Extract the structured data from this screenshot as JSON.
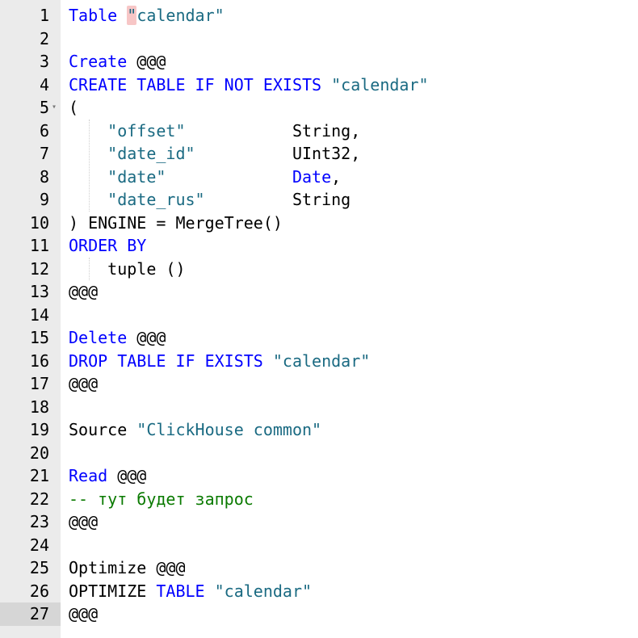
{
  "editor": {
    "active_line": 27,
    "lines": [
      {
        "n": "1",
        "tokens": [
          {
            "t": "Table",
            "c": "kw"
          },
          {
            "t": " ",
            "c": ""
          },
          {
            "t": "\"",
            "c": "str q1"
          },
          {
            "t": "calendar\"",
            "c": "str"
          }
        ]
      },
      {
        "n": "2",
        "tokens": []
      },
      {
        "n": "3",
        "tokens": [
          {
            "t": "Create",
            "c": "kw"
          },
          {
            "t": " @@@",
            "c": ""
          }
        ]
      },
      {
        "n": "4",
        "tokens": [
          {
            "t": "CREATE TABLE IF NOT EXISTS",
            "c": "kw"
          },
          {
            "t": " ",
            "c": ""
          },
          {
            "t": "\"calendar\"",
            "c": "str"
          }
        ]
      },
      {
        "n": "5",
        "fold": true,
        "tokens": [
          {
            "t": "(",
            "c": ""
          }
        ]
      },
      {
        "n": "6",
        "tokens": [
          {
            "t": "    ",
            "c": ""
          },
          {
            "t": "\"offset\"",
            "c": "str"
          },
          {
            "t": "           String,",
            "c": ""
          }
        ]
      },
      {
        "n": "7",
        "tokens": [
          {
            "t": "    ",
            "c": ""
          },
          {
            "t": "\"date_id\"",
            "c": "str"
          },
          {
            "t": "          UInt32,",
            "c": ""
          }
        ]
      },
      {
        "n": "8",
        "tokens": [
          {
            "t": "    ",
            "c": ""
          },
          {
            "t": "\"date\"",
            "c": "str"
          },
          {
            "t": "             ",
            "c": ""
          },
          {
            "t": "Date",
            "c": "kw"
          },
          {
            "t": ",",
            "c": ""
          }
        ]
      },
      {
        "n": "9",
        "tokens": [
          {
            "t": "    ",
            "c": ""
          },
          {
            "t": "\"date_rus\"",
            "c": "str"
          },
          {
            "t": "         String",
            "c": ""
          }
        ]
      },
      {
        "n": "10",
        "tokens": [
          {
            "t": ") ENGINE = MergeTree()",
            "c": ""
          }
        ]
      },
      {
        "n": "11",
        "tokens": [
          {
            "t": "ORDER BY",
            "c": "kw"
          }
        ]
      },
      {
        "n": "12",
        "tokens": [
          {
            "t": "    tuple ()",
            "c": ""
          }
        ]
      },
      {
        "n": "13",
        "tokens": [
          {
            "t": "@@@",
            "c": ""
          }
        ]
      },
      {
        "n": "14",
        "tokens": []
      },
      {
        "n": "15",
        "tokens": [
          {
            "t": "Delete",
            "c": "kw"
          },
          {
            "t": " @@@",
            "c": ""
          }
        ]
      },
      {
        "n": "16",
        "tokens": [
          {
            "t": "DROP TABLE IF EXISTS",
            "c": "kw"
          },
          {
            "t": " ",
            "c": ""
          },
          {
            "t": "\"calendar\"",
            "c": "str"
          }
        ]
      },
      {
        "n": "17",
        "tokens": [
          {
            "t": "@@@",
            "c": ""
          }
        ]
      },
      {
        "n": "18",
        "tokens": []
      },
      {
        "n": "19",
        "tokens": [
          {
            "t": "Source ",
            "c": ""
          },
          {
            "t": "\"ClickHouse common\"",
            "c": "str"
          }
        ]
      },
      {
        "n": "20",
        "tokens": []
      },
      {
        "n": "21",
        "tokens": [
          {
            "t": "Read",
            "c": "kw"
          },
          {
            "t": " @@@",
            "c": ""
          }
        ]
      },
      {
        "n": "22",
        "tokens": [
          {
            "t": "-- тут будет запрос",
            "c": "cm"
          }
        ]
      },
      {
        "n": "23",
        "tokens": [
          {
            "t": "@@@",
            "c": ""
          }
        ]
      },
      {
        "n": "24",
        "tokens": []
      },
      {
        "n": "25",
        "tokens": [
          {
            "t": "Optimize @@@",
            "c": ""
          }
        ]
      },
      {
        "n": "26",
        "tokens": [
          {
            "t": "OPTIMIZE ",
            "c": ""
          },
          {
            "t": "TABLE",
            "c": "kw"
          },
          {
            "t": " ",
            "c": ""
          },
          {
            "t": "\"calendar\"",
            "c": "str"
          }
        ]
      },
      {
        "n": "27",
        "tokens": [
          {
            "t": "@@@",
            "c": ""
          }
        ]
      }
    ]
  },
  "colors": {
    "keyword": "#0000ff",
    "string": "#1a6a82",
    "comment": "#0a7a00",
    "gutter": "#ebebeb",
    "active_gutter": "#d6d6d6",
    "bracket_match": "#f7c6c6"
  },
  "icons": {
    "fold": "fold-arrow-icon"
  }
}
